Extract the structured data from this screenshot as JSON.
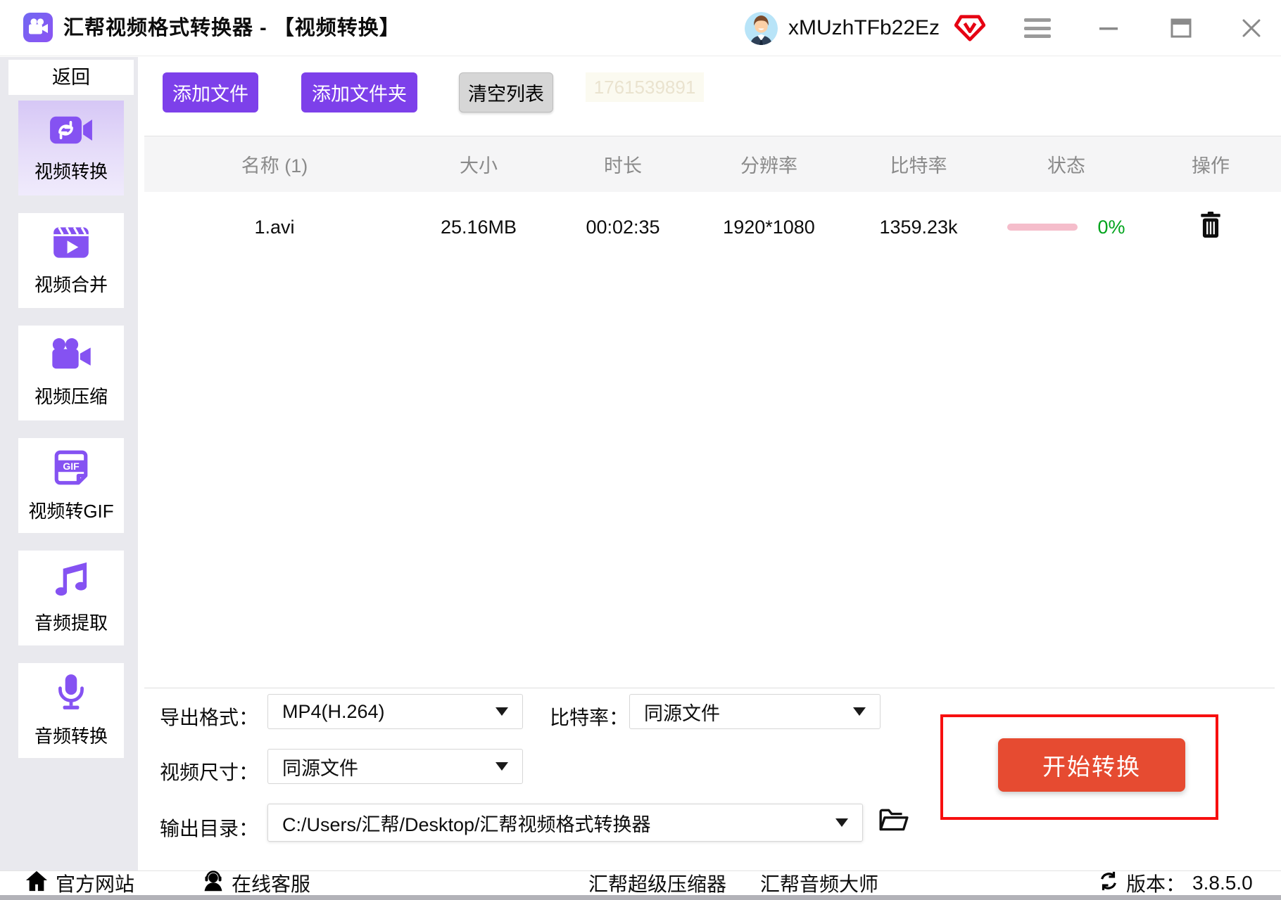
{
  "titlebar": {
    "app_title": "汇帮视频格式转换器 - 【视频转换】",
    "username": "xMUzhTFb22Ez",
    "icons": {
      "logo": "video-camera",
      "badge": "vip-shield",
      "menu": "hamburger",
      "window": [
        "minimize",
        "maximize",
        "close"
      ]
    }
  },
  "sidebar": {
    "back_label": "返回",
    "items": [
      {
        "label": "视频转换",
        "icon": "video-convert-icon",
        "active": true
      },
      {
        "label": "视频合并",
        "icon": "video-merge-icon",
        "active": false
      },
      {
        "label": "视频压缩",
        "icon": "video-compress-icon",
        "active": false
      },
      {
        "label": "视频转GIF",
        "icon": "video-to-gif-icon",
        "active": false
      },
      {
        "label": "音频提取",
        "icon": "audio-extract-icon",
        "active": false
      },
      {
        "label": "音频转换",
        "icon": "audio-convert-icon",
        "active": false
      }
    ]
  },
  "toolbar": {
    "add_file_label": "添加文件",
    "add_folder_label": "添加文件夹",
    "clear_list_label": "清空列表",
    "watermark": "1761539891"
  },
  "table": {
    "headers": [
      "名称 (1)",
      "大小",
      "时长",
      "分辨率",
      "比特率",
      "状态",
      "操作"
    ],
    "rows": [
      {
        "name": "1.avi",
        "size": "25.16MB",
        "duration": "00:02:35",
        "resolution": "1920*1080",
        "bitrate": "1359.23k",
        "progress": "0%"
      }
    ]
  },
  "settings": {
    "export_format_label": "导出格式：",
    "export_format_value": "MP4(H.264)",
    "bitrate_label": "比特率：",
    "bitrate_value": "同源文件",
    "video_size_label": "视频尺寸：",
    "video_size_value": "同源文件",
    "output_dir_label": "输出目录：",
    "output_dir_value": "C:/Users/汇帮/Desktop/汇帮视频格式转换器",
    "start_button_label": "开始转换"
  },
  "footer": {
    "official_site": "官方网站",
    "online_support": "在线客服",
    "super_compressor": "汇帮超级压缩器",
    "audio_master": "汇帮音频大师",
    "version_label": "版本：",
    "version_value": "3.8.5.0"
  },
  "colors": {
    "accent_purple": "#7d40ea",
    "sidebar_icon_purple": "#8552f2",
    "start_button_red": "#e64b31",
    "annotation_red": "#f70f0f",
    "progress_pink": "#f5bdcb",
    "progress_green": "#00a41c",
    "vip_red": "#e60012"
  }
}
